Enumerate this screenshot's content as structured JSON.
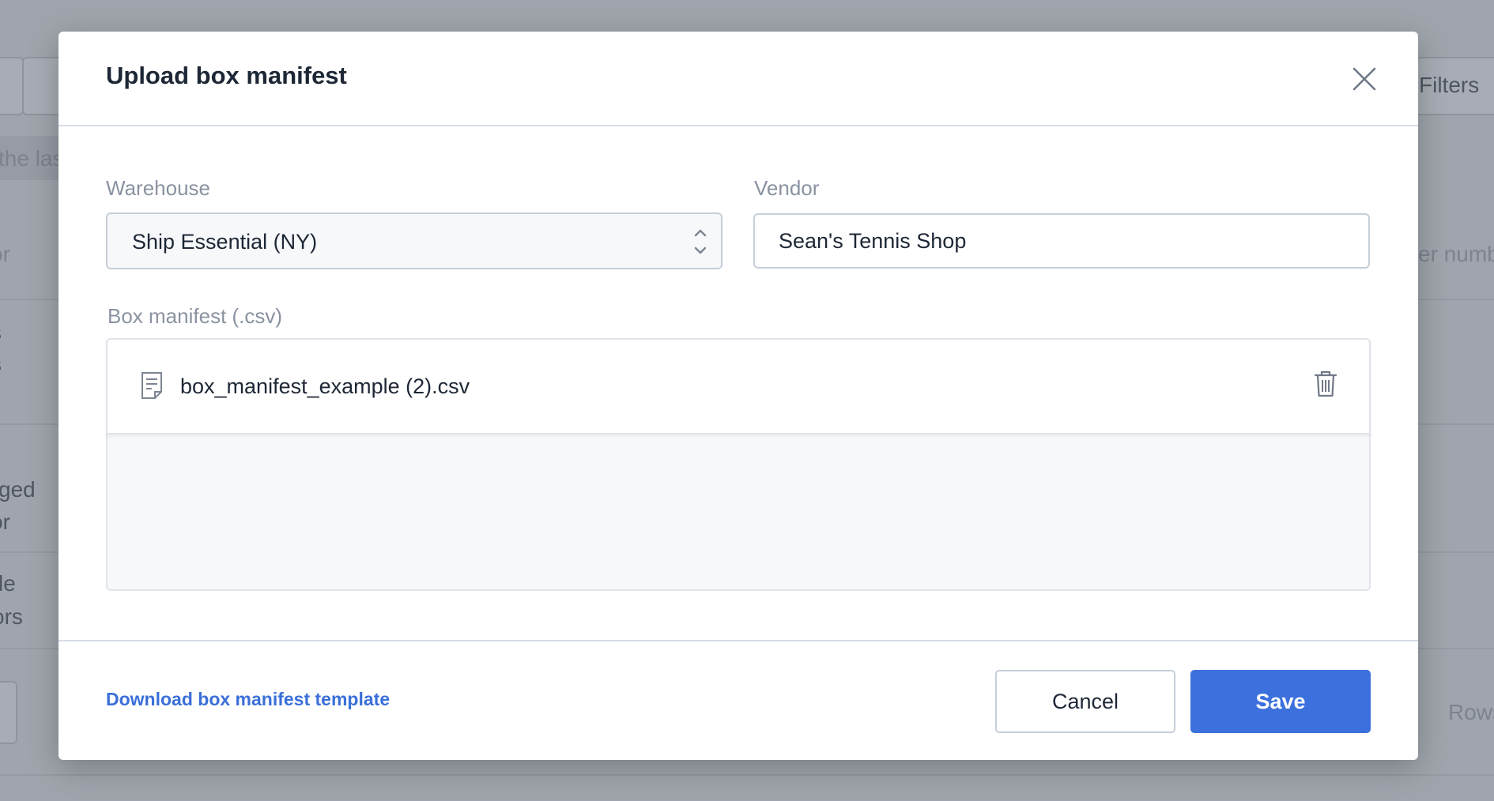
{
  "background": {
    "filters_label": "Filters",
    "fragments": [
      "the las",
      "or",
      "s",
      "s",
      "ged",
      "or",
      "le",
      "ors",
      "er numb",
      "Rows"
    ]
  },
  "modal": {
    "title": "Upload box manifest",
    "close_icon": "close-icon",
    "warehouse": {
      "label": "Warehouse",
      "value": "Ship Essential (NY)"
    },
    "vendor": {
      "label": "Vendor",
      "value": "Sean's Tennis Shop"
    },
    "manifest": {
      "label": "Box manifest (.csv)",
      "file_name": "box_manifest_example (2).csv",
      "file_icon": "file-icon",
      "delete_icon": "trash-icon"
    },
    "footer": {
      "download_link": "Download box manifest template",
      "cancel_label": "Cancel",
      "save_label": "Save"
    }
  },
  "colors": {
    "accent": "#3c71dd",
    "link": "#3a6fd8",
    "overlay": "#a0a5ad"
  }
}
